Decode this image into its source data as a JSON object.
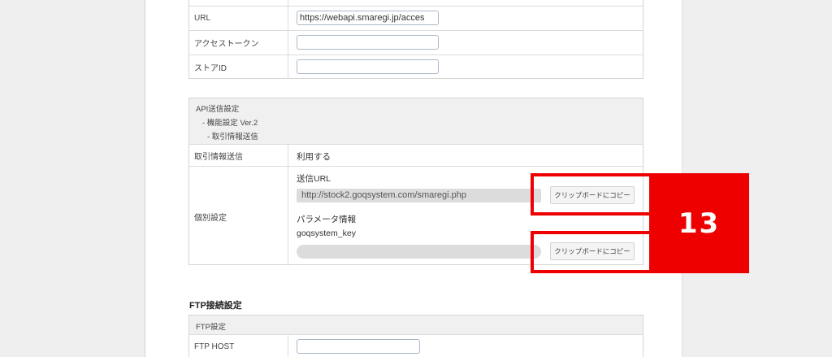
{
  "api_table": {
    "rows": [
      {
        "label": "URL",
        "value": "https://webapi.smaregi.jp/acces"
      },
      {
        "label": "アクセストークン",
        "value": ""
      },
      {
        "label": "ストアID",
        "value": ""
      }
    ]
  },
  "send_settings": {
    "header_lines": [
      "API送信設定",
      "- 機能設定 Ver.2",
      "- 取引情報送信"
    ],
    "transaction_send_label": "取引情報送信",
    "transaction_send_value": "利用する",
    "individual_label": "個別設定",
    "send_url_label": "送信URL",
    "send_url_value": "http://stock2.goqsystem.com/smaregi.php",
    "param_label": "パラメータ情報",
    "param_key": "goqsystem_key",
    "param_value": "",
    "copy_button_label": "クリップボードにコピー"
  },
  "annotation": {
    "step_number": "13",
    "color": "#ee0000"
  },
  "ftp": {
    "section_title": "FTP接続設定",
    "header": "FTP設定",
    "host_label": "FTP HOST",
    "host_value": ""
  }
}
